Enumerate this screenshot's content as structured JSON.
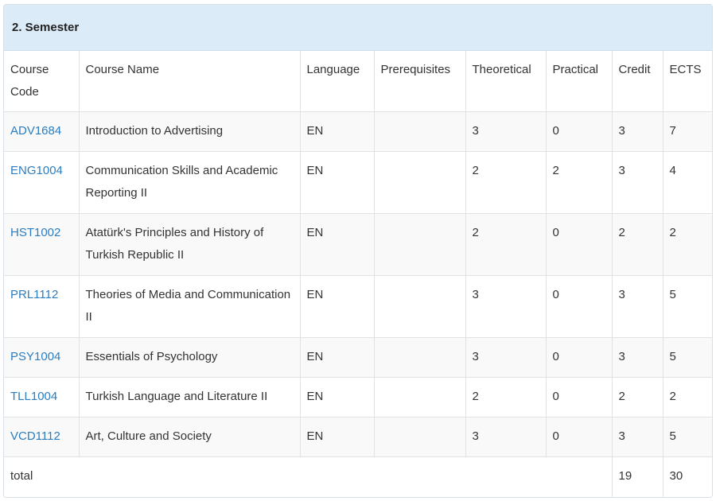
{
  "panel": {
    "title": "2. Semester"
  },
  "columns": [
    "Course Code",
    "Course Name",
    "Language",
    "Prerequisites",
    "Theoretical",
    "Practical",
    "Credit",
    "ECTS"
  ],
  "rows": [
    {
      "code": "ADV1684",
      "name": "Introduction to Advertising",
      "language": "EN",
      "prerequisites": "",
      "theoretical": "3",
      "practical": "0",
      "credit": "3",
      "ects": "7"
    },
    {
      "code": "ENG1004",
      "name": "Communication Skills and Academic Reporting II",
      "language": "EN",
      "prerequisites": "",
      "theoretical": "2",
      "practical": "2",
      "credit": "3",
      "ects": "4"
    },
    {
      "code": "HST1002",
      "name": "Atatürk's Principles and History of Turkish Republic II",
      "language": "EN",
      "prerequisites": "",
      "theoretical": "2",
      "practical": "0",
      "credit": "2",
      "ects": "2"
    },
    {
      "code": "PRL1112",
      "name": "Theories of Media and Communication II",
      "language": "EN",
      "prerequisites": "",
      "theoretical": "3",
      "practical": "0",
      "credit": "3",
      "ects": "5"
    },
    {
      "code": "PSY1004",
      "name": "Essentials of Psychology",
      "language": "EN",
      "prerequisites": "",
      "theoretical": "3",
      "practical": "0",
      "credit": "3",
      "ects": "5"
    },
    {
      "code": "TLL1004",
      "name": "Turkish Language and Literature II",
      "language": "EN",
      "prerequisites": "",
      "theoretical": "2",
      "practical": "0",
      "credit": "2",
      "ects": "2"
    },
    {
      "code": "VCD1112",
      "name": "Art, Culture and Society",
      "language": "EN",
      "prerequisites": "",
      "theoretical": "3",
      "practical": "0",
      "credit": "3",
      "ects": "5"
    }
  ],
  "total": {
    "label": "total",
    "credit": "19",
    "ects": "30"
  },
  "colors": {
    "heading_bg": "#dcebf8",
    "link": "#2a7dc0",
    "stripe": "#f9f9f9"
  }
}
